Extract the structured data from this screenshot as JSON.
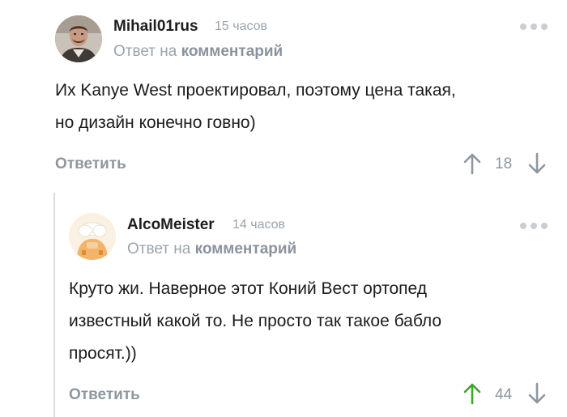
{
  "comments": [
    {
      "username": "Mihail01rus",
      "time": "15 часов",
      "reply_prefix": "Ответ на",
      "reply_link": "комментарий",
      "lines": [
        "Их Kanye West проектировал, поэтому цена такая,",
        "но дизайн конечно говно)"
      ],
      "reply_label": "Ответить",
      "score": "18",
      "upvoted": false
    },
    {
      "username": "AlcoMeister",
      "time": "14 часов",
      "reply_prefix": "Ответ на",
      "reply_link": "комментарий",
      "lines": [
        "Круто жи. Наверное этот Коний Вест ортопед",
        "известный какой то. Не просто так такое бабло",
        "просят.))"
      ],
      "reply_label": "Ответить",
      "score": "44",
      "upvoted": true
    }
  ],
  "colors": {
    "upvote_active": "#3fa52d",
    "muted": "#8e979f",
    "thread_line": "#d9dde3"
  },
  "icons": {
    "more": "more-dots-icon",
    "upvote": "arrow-up-icon",
    "downvote": "arrow-down-icon"
  }
}
